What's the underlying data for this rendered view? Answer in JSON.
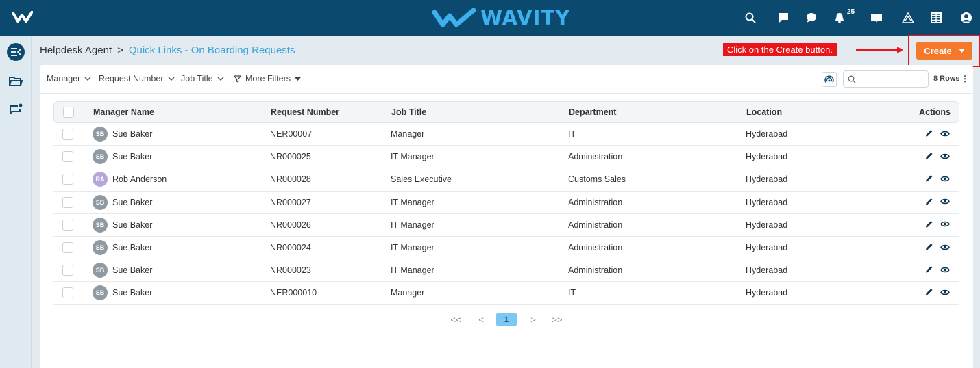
{
  "brand": {
    "name": "WAVITY",
    "primary_color": "#0b4a6e",
    "accent_color": "#3db1f0"
  },
  "topbar": {
    "notification_count": "25",
    "icons": [
      "search-icon",
      "chat-square-icon",
      "chat-bubble-icon",
      "bell-icon",
      "book-icon",
      "alert-triangle-icon",
      "grid-icon",
      "user-icon"
    ]
  },
  "sidebar": {
    "icons": [
      "collapse-menu-icon",
      "folder-icon",
      "message-add-icon"
    ]
  },
  "breadcrumb": {
    "root": "Helpdesk Agent",
    "separator": ">",
    "current": "Quick Links - On Boarding Requests"
  },
  "annotation": {
    "text": "Click on the Create button.",
    "color": "#e8161b"
  },
  "create_button": {
    "label": "Create",
    "color": "#f5792a"
  },
  "filters": {
    "items": [
      "Manager",
      "Request Number",
      "Job Title",
      "More Filters"
    ],
    "search_placeholder": "",
    "rows_label": "8 Rows"
  },
  "table": {
    "columns": [
      "Manager Name",
      "Request Number",
      "Job Title",
      "Department",
      "Location",
      "Actions"
    ],
    "rows": [
      {
        "initials": "SB",
        "manager": "Sue Baker",
        "request": "NER00007",
        "job": "Manager",
        "department": "IT",
        "location": "Hyderabad"
      },
      {
        "initials": "SB",
        "manager": "Sue Baker",
        "request": "NR000025",
        "job": "IT Manager",
        "department": "Administration",
        "location": "Hyderabad"
      },
      {
        "initials": "RA",
        "manager": "Rob Anderson",
        "request": "NR000028",
        "job": "Sales Executive",
        "department": "Customs Sales",
        "location": "Hyderabad"
      },
      {
        "initials": "SB",
        "manager": "Sue Baker",
        "request": "NR000027",
        "job": "IT Manager",
        "department": "Administration",
        "location": "Hyderabad"
      },
      {
        "initials": "SB",
        "manager": "Sue Baker",
        "request": "NR000026",
        "job": "IT Manager",
        "department": "Administration",
        "location": "Hyderabad"
      },
      {
        "initials": "SB",
        "manager": "Sue Baker",
        "request": "NR000024",
        "job": "IT Manager",
        "department": "Administration",
        "location": "Hyderabad"
      },
      {
        "initials": "SB",
        "manager": "Sue Baker",
        "request": "NR000023",
        "job": "IT Manager",
        "department": "Administration",
        "location": "Hyderabad"
      },
      {
        "initials": "SB",
        "manager": "Sue Baker",
        "request": "NER000010",
        "job": "Manager",
        "department": "IT",
        "location": "Hyderabad"
      }
    ]
  },
  "pagination": {
    "first": "<<",
    "prev": "<",
    "current": "1",
    "next": ">",
    "last": ">>"
  }
}
